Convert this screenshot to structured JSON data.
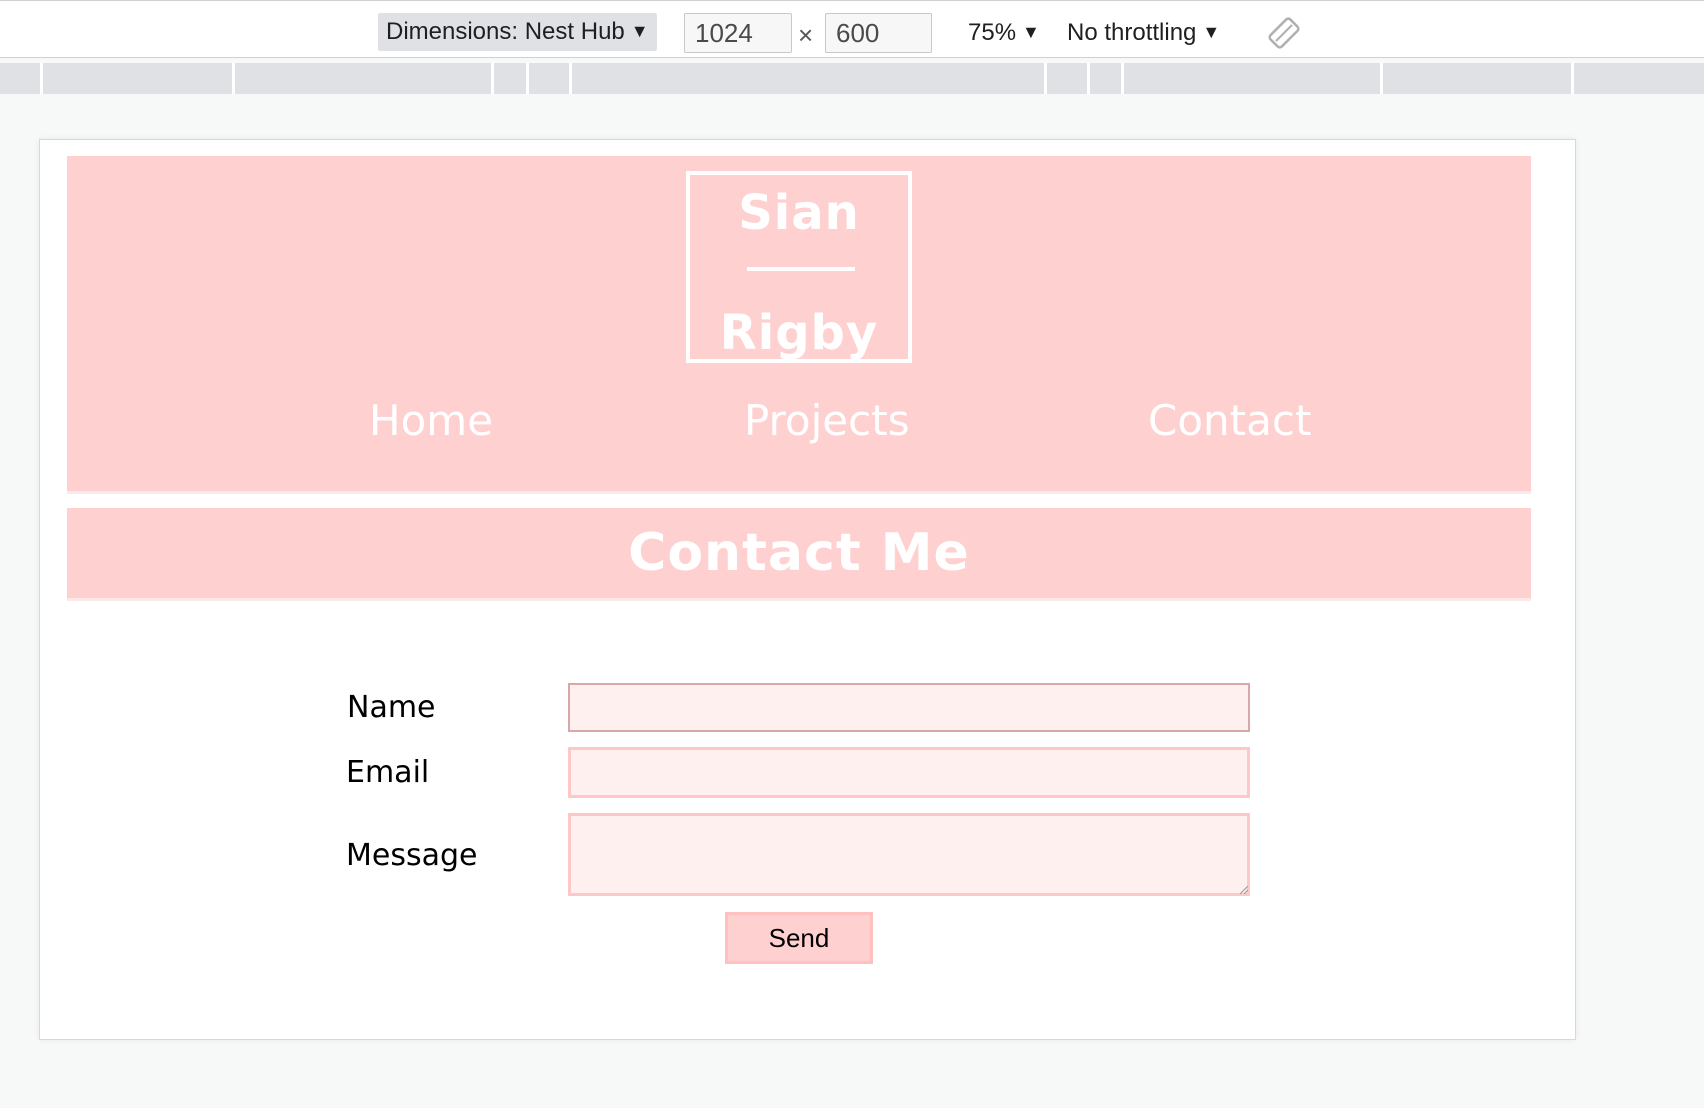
{
  "devtools": {
    "dimensions_label": "Dimensions: Nest Hub",
    "width_value": "1024",
    "height_value": "600",
    "times_symbol": "×",
    "zoom_label": "75%",
    "throttling_label": "No throttling",
    "caret": "▼"
  },
  "site": {
    "logo": {
      "first_name": "Sian",
      "last_name": "Rigby"
    },
    "nav": [
      {
        "label": "Home"
      },
      {
        "label": "Projects"
      },
      {
        "label": "Contact"
      }
    ],
    "page_title": "Contact Me",
    "form": {
      "name_label": "Name",
      "email_label": "Email",
      "message_label": "Message",
      "name_value": "",
      "email_value": "",
      "message_value": "",
      "send_label": "Send"
    }
  },
  "colors": {
    "accent_pink": "#ffd0d0",
    "field_bg": "#fff0f0",
    "text_white": "#ffffff"
  }
}
